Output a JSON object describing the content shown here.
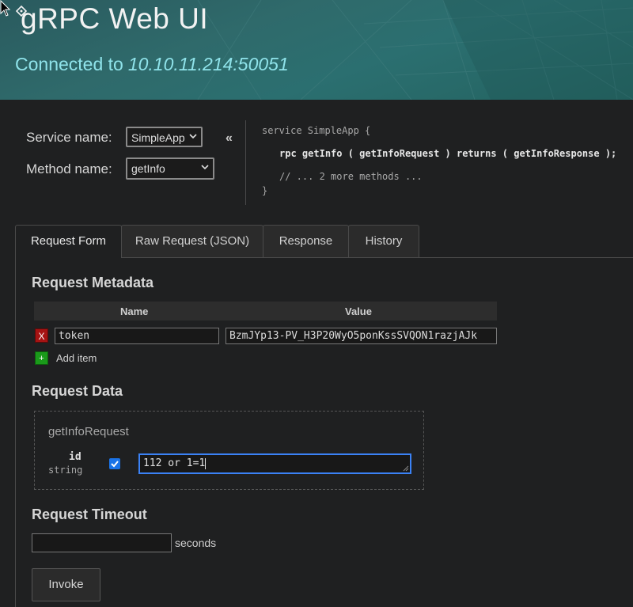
{
  "header": {
    "title": "gRPC  Web UI",
    "connected_prefix": "Connected to",
    "address": "10.10.11.214:50051"
  },
  "selection": {
    "service_label": "Service name:",
    "service_value": "SimpleApp",
    "method_label": "Method name:",
    "method_value": "getInfo",
    "collapse_symbol": "«"
  },
  "proto": {
    "line1": "service SimpleApp {",
    "line2_kw": "rpc",
    "line2": "getInfo ( getInfoRequest ) returns ( getInfoResponse );",
    "line3": "// ... 2 more methods ...",
    "line4": "}"
  },
  "tabs": [
    {
      "label": "Request Form",
      "active": true
    },
    {
      "label": "Raw Request (JSON)",
      "active": false
    },
    {
      "label": "Response",
      "active": false
    },
    {
      "label": "History",
      "active": false
    }
  ],
  "metadata": {
    "heading": "Request Metadata",
    "col_name": "Name",
    "col_value": "Value",
    "rows": [
      {
        "name": "token",
        "value": "BzmJYp13-PV_H3P20WyO5ponKssSVQON1razjAJk"
      }
    ],
    "remove_symbol": "X",
    "add_symbol": "+",
    "add_label": "Add item"
  },
  "request_data": {
    "heading": "Request Data",
    "message_type": "getInfoRequest",
    "field_name": "id",
    "field_type": "string",
    "field_value": "112 or 1=1"
  },
  "timeout": {
    "heading": "Request Timeout",
    "value": "",
    "unit": "seconds"
  },
  "invoke_label": "Invoke",
  "colors": {
    "header_bg": "#2b6466",
    "accent_text": "#8fe3ea",
    "body_bg": "#1f2021",
    "remove_red": "#a51313",
    "add_green": "#1a9a1a",
    "focus_blue": "#3b82f6"
  }
}
